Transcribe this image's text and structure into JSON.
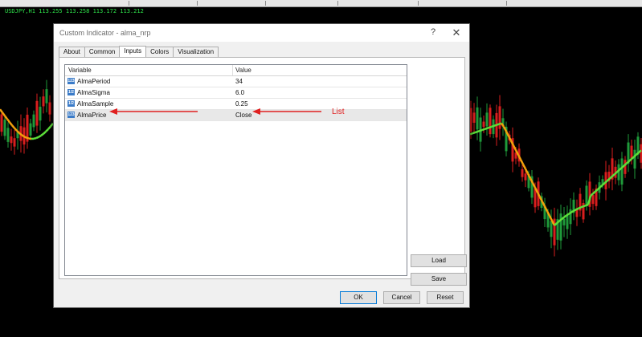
{
  "chart": {
    "symbol_line": "USDJPY,H1  113.255 113.258 113.172 113.212",
    "colors": {
      "background": "#000000",
      "bull": "#1f9a3a",
      "bear": "#d81e1e",
      "ma_up": "#5ee03a",
      "ma_down": "#f2a20c"
    }
  },
  "dialog": {
    "title": "Custom Indicator - alma_nrp",
    "help_label": "?",
    "close_label": "✕",
    "tabs": [
      {
        "label": "About",
        "active": false
      },
      {
        "label": "Common",
        "active": false
      },
      {
        "label": "Inputs",
        "active": true
      },
      {
        "label": "Colors",
        "active": false
      },
      {
        "label": "Visualization",
        "active": false
      }
    ],
    "grid": {
      "col_variable": "Variable",
      "col_value": "Value",
      "rows": [
        {
          "icon_text": "123",
          "variable": "AlmaPeriod",
          "value": "34"
        },
        {
          "icon_text": "1/2",
          "variable": "AlmaSigma",
          "value": "6.0"
        },
        {
          "icon_text": "1/2",
          "variable": "AlmaSample",
          "value": "0.25"
        },
        {
          "icon_text": "123",
          "variable": "AlmaPrice",
          "value": "Close"
        }
      ]
    },
    "load_label": "Load",
    "save_label": "Save",
    "ok_label": "OK",
    "cancel_label": "Cancel",
    "reset_label": "Reset"
  },
  "annotation": {
    "label": "List",
    "color": "#e02020"
  },
  "icons": {
    "param_icon": "parameter-type-icon"
  }
}
